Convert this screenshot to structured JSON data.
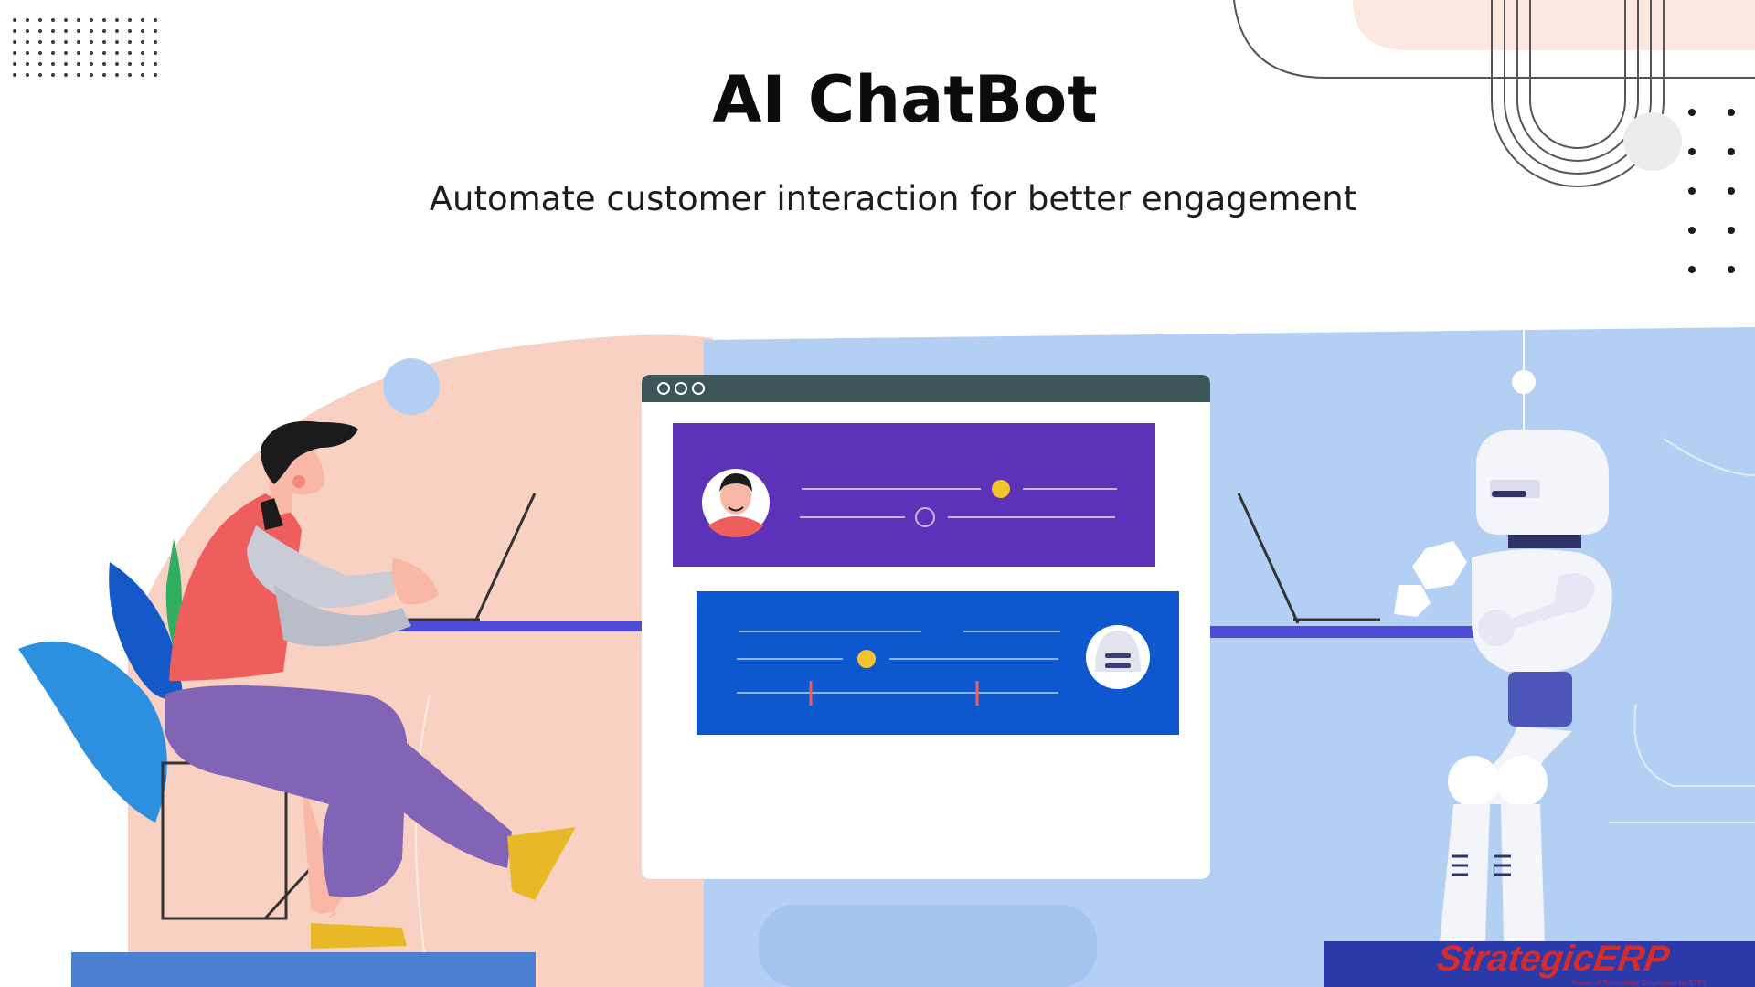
{
  "slide": {
    "title": "AI ChatBot",
    "subtitle": "Automate customer interaction for better engagement"
  },
  "logo": {
    "wordmark": "StrategicERP",
    "tagline": "Power of Technology Developed by STPL"
  },
  "colors": {
    "pink_bg": "#f9d1c3",
    "blue_bg": "#b3cff3",
    "purple_card": "#5b32b8",
    "blue_card": "#0d58cf",
    "window_bar": "#3d5659",
    "accent_yellow": "#f4c430",
    "desk_blue": "#4f4bd6",
    "logo_red": "#d62b2b"
  },
  "icons": [
    "person-avatar-icon",
    "robot-avatar-icon",
    "window-control-dots-icon"
  ]
}
